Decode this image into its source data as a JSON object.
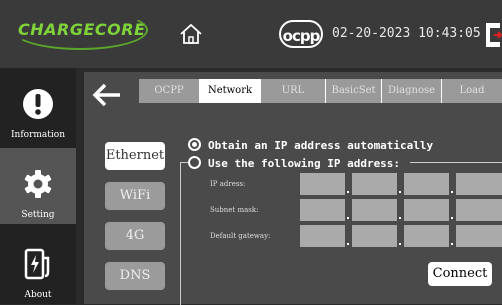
{
  "header": {
    "brand": "CHARGECORE",
    "ocpp_logo": "ocpp",
    "datetime": "02-20-2023 10:43:05"
  },
  "sidebar": {
    "items": [
      {
        "label": "Information",
        "icon": "exclamation-icon"
      },
      {
        "label": "Setting",
        "icon": "gear-icon",
        "active": true
      },
      {
        "label": "About",
        "icon": "charger-icon"
      }
    ]
  },
  "tabs": [
    "OCPP",
    "Network",
    "URL",
    "BasicSet",
    "Diagnose",
    "Load"
  ],
  "active_tab": "Network",
  "network_types": [
    "Ethernet",
    "WiFi",
    "4G",
    "DNS"
  ],
  "active_network_type": "Ethernet",
  "options": {
    "auto": "Obtain an IP address automatically",
    "manual": "Use the following IP address:"
  },
  "fields": {
    "ip_address": "IP adress:",
    "subnet_mask": "Subnet mask:",
    "default_gateway": "Default gateway:"
  },
  "connect_label": "Connect",
  "colors": {
    "brand_green": "#7fd23a",
    "active_sidebar": "#555555",
    "tab_inactive": "#9a9a9a"
  }
}
